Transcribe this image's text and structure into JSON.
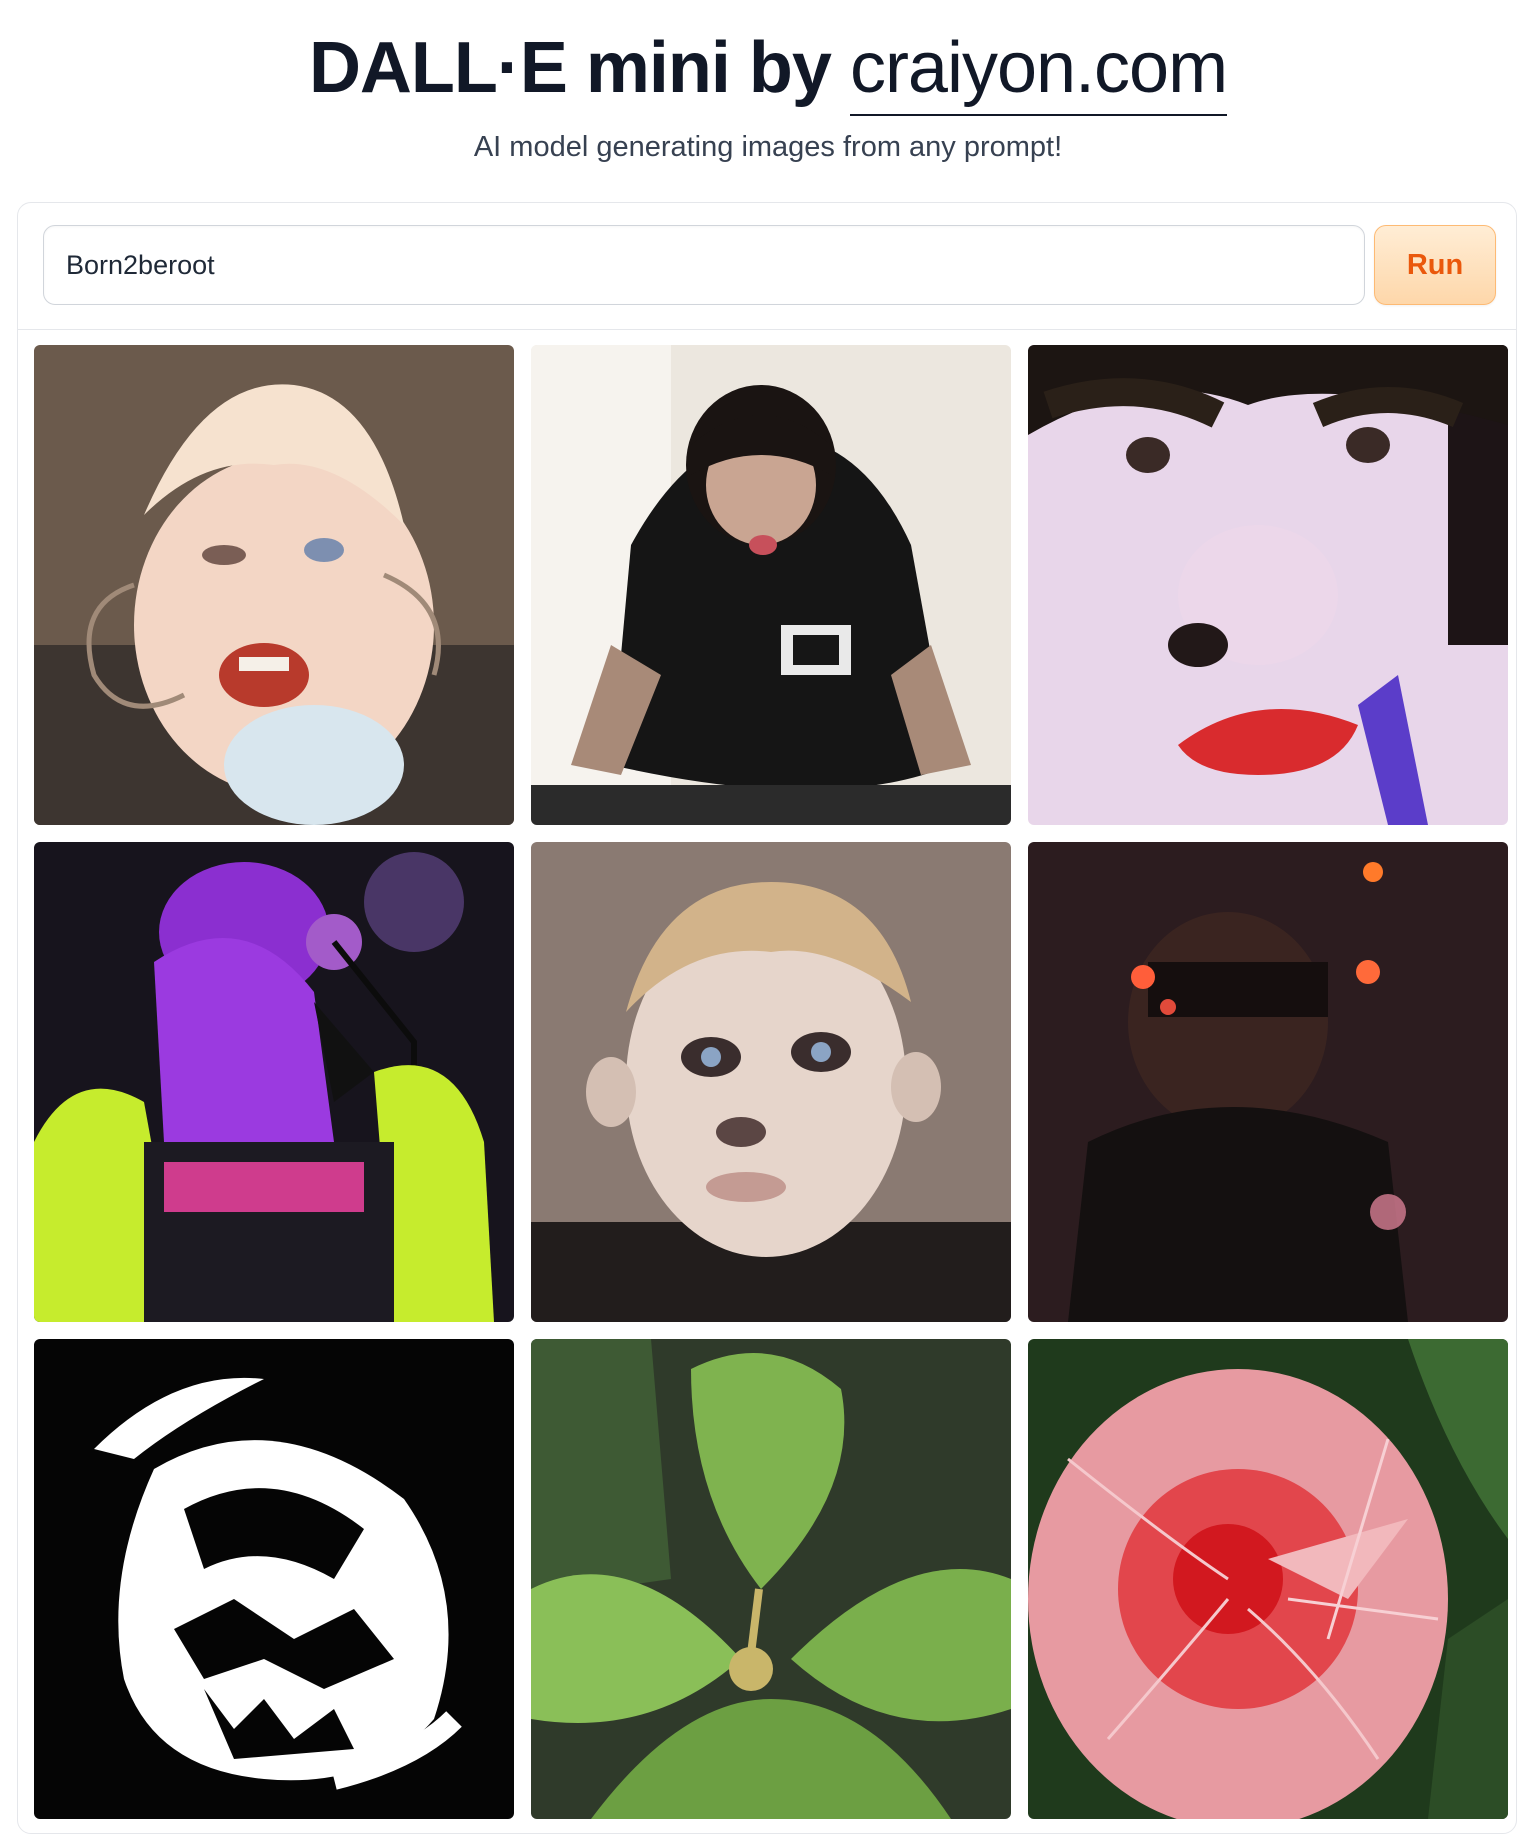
{
  "header": {
    "title_main": "DALL·E mini by ",
    "title_brand": "craiyon.com",
    "subtitle": "AI model generating images from any prompt!"
  },
  "prompt": {
    "value": "Born2beroot"
  },
  "toolbar": {
    "run_label": "Run"
  },
  "colors": {
    "accent": "#ea580c",
    "button_bg": "#fed7aa",
    "border": "#e5e7eb"
  },
  "results": [
    {
      "name": "generated-image-1",
      "description": "distorted blonde child face with wires"
    },
    {
      "name": "generated-image-2",
      "description": "dark-haired man in black t-shirt crouching"
    },
    {
      "name": "generated-image-3",
      "description": "pale distorted face with red lips close-up"
    },
    {
      "name": "generated-image-4",
      "description": "singer with microphone under purple light, neon yellow jacket"
    },
    {
      "name": "generated-image-5",
      "description": "blonde boy portrait with dark eyes"
    },
    {
      "name": "generated-image-6",
      "description": "dark figure with red lights"
    },
    {
      "name": "generated-image-7",
      "description": "black and white skull-like graphic"
    },
    {
      "name": "generated-image-8",
      "description": "green leafy plant sprout"
    },
    {
      "name": "generated-image-9",
      "description": "pink veined flower close-up"
    }
  ]
}
